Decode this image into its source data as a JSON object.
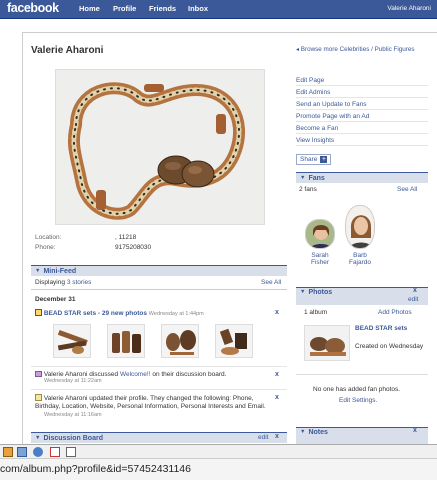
{
  "topbar": {
    "logo": "facebook",
    "nav": [
      "Home",
      "Profile",
      "Friends",
      "Inbox"
    ],
    "user": "Valerie Aharoni"
  },
  "profile": {
    "name": "Valerie Aharoni",
    "browse_link": "Browse more Celebrities / Public Figures",
    "location_label": "Location:",
    "location_value": ", 11218",
    "phone_label": "Phone:",
    "phone_value": "9175208030"
  },
  "actions": [
    "Edit Page",
    "Edit Admins",
    "Send an Update to Fans",
    "Promote Page with an Ad",
    "Become a Fan",
    "View Insights"
  ],
  "share_label": "Share",
  "fans": {
    "title": "Fans",
    "count": "2 fans",
    "see_all": "See All",
    "people": [
      {
        "first": "Sarah",
        "last": "Fisher"
      },
      {
        "first": "Barb",
        "last": "Fajardo"
      }
    ]
  },
  "photos": {
    "title": "Photos",
    "edit": "edit",
    "x": "x",
    "count": "1 album",
    "add": "Add Photos",
    "album_title": "BEAD STAR sets",
    "album_created": "Created on Wednesday",
    "no_fan_photos": "No one has added fan photos.",
    "edit_settings": "Edit Settings."
  },
  "notes": {
    "title": "Notes",
    "x": "x"
  },
  "minifeed": {
    "title": "Mini-Feed",
    "displaying": "Displaying",
    "stories": "3 stories",
    "see_all": "See All",
    "date": "December 31",
    "item1_title": "BEAD STAR sets - 29 new photos",
    "item1_time": "Wednesday at 1:44pm",
    "item2_text_a": "Valerie Aharoni discussed",
    "item2_link": "Welcome!!",
    "item2_text_b": "on their discussion board.",
    "item2_time": "Wednesday at 11:22am",
    "item3_text": "Valerie Aharoni updated their profile. They changed the following: Phone, Birthday, Location, Website, Personal Information, Personal Interests and Email.",
    "item3_time": "Wednesday at 11:16am",
    "x": "x"
  },
  "discussion": {
    "title": "Discussion Board",
    "edit": "edit",
    "x": "x"
  },
  "statusbar": {
    "url": "com/album.php?profile&id=57452431146"
  }
}
